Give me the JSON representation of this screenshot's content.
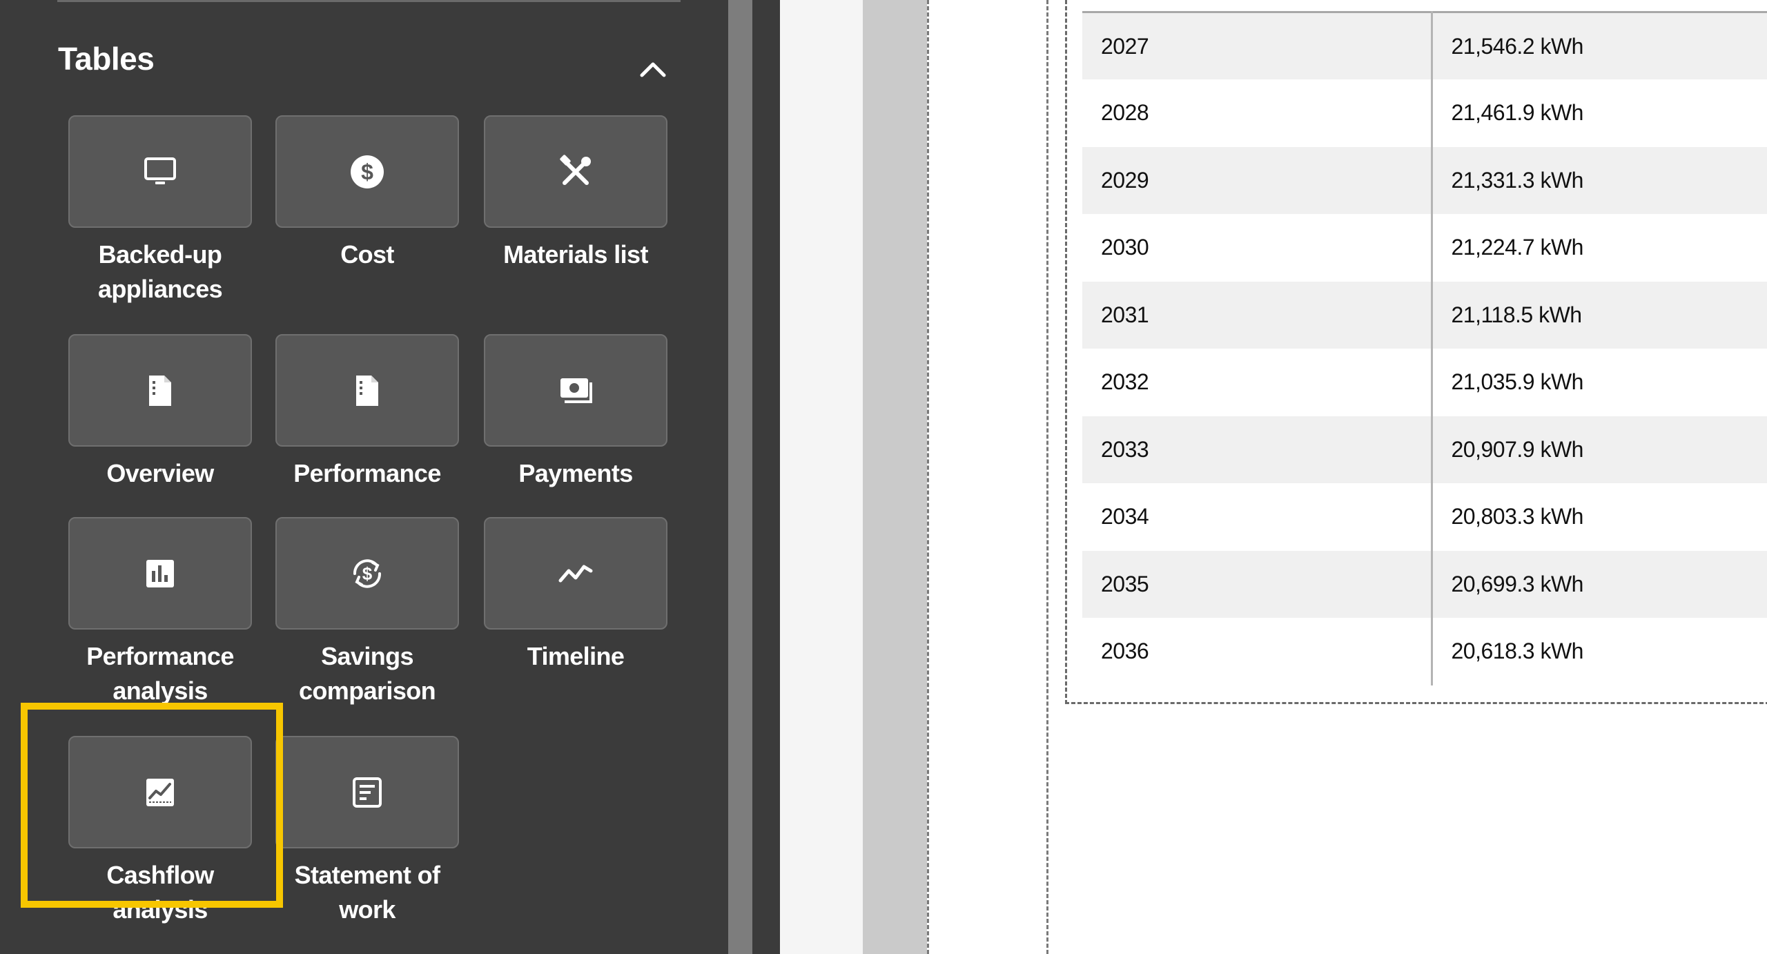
{
  "sidebar": {
    "section_title": "Tables",
    "tiles": [
      {
        "label_1": "Backed-up",
        "label_2": "appliances",
        "icon": "monitor-icon"
      },
      {
        "label_1": "Cost",
        "icon": "dollar-circle-icon"
      },
      {
        "label_1": "Materials list",
        "icon": "tools-icon"
      },
      {
        "label_1": "Overview",
        "icon": "document-icon"
      },
      {
        "label_1": "Performance",
        "icon": "document-icon"
      },
      {
        "label_1": "Payments",
        "icon": "cash-icon"
      },
      {
        "label_1": "Performance",
        "label_2": "analysis",
        "icon": "bar-chart-icon"
      },
      {
        "label_1": "Savings",
        "label_2": "comparison",
        "icon": "dollar-cycle-icon"
      },
      {
        "label_1": "Timeline",
        "icon": "trend-line-icon"
      },
      {
        "label_1": "Cashflow analysis",
        "icon": "area-chart-icon"
      },
      {
        "label_1": "Statement of",
        "label_2": "work",
        "icon": "statement-icon"
      }
    ],
    "highlighted_tile": "Cashflow analysis",
    "highlight_color": "#f7c600"
  },
  "table": {
    "rows": [
      {
        "year": "2027",
        "value": "21,546.2 kWh"
      },
      {
        "year": "2028",
        "value": "21,461.9 kWh"
      },
      {
        "year": "2029",
        "value": "21,331.3 kWh"
      },
      {
        "year": "2030",
        "value": "21,224.7 kWh"
      },
      {
        "year": "2031",
        "value": "21,118.5 kWh"
      },
      {
        "year": "2032",
        "value": "21,035.9 kWh"
      },
      {
        "year": "2033",
        "value": "20,907.9 kWh"
      },
      {
        "year": "2034",
        "value": "20,803.3 kWh"
      },
      {
        "year": "2035",
        "value": "20,699.3 kWh"
      },
      {
        "year": "2036",
        "value": "20,618.3 kWh"
      }
    ]
  }
}
